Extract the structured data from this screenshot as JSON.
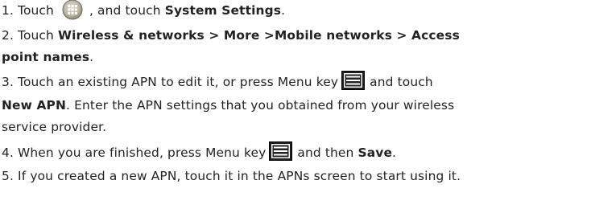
{
  "steps": [
    {
      "prefix": "1. Touch",
      "mid": ", and touch",
      "target": "System Settings",
      "end": "."
    },
    {
      "prefix": "2. Touch",
      "path": "Wireless & networks > More >Mobile networks > Access",
      "path_cont": "point names",
      "end": "."
    },
    {
      "prefix": "3. Touch an existing APN to edit it, or press Menu key",
      "mid": "and touch",
      "target": "New APN",
      "rest": ". Enter the APN settings that you obtained from your wireless",
      "rest_cont": "service provider."
    },
    {
      "prefix": "4. When you are finished, press Menu key",
      "mid": "and then",
      "target": "Save",
      "end": "."
    },
    {
      "text": "5. If you created a new APN, touch it in the APNs screen to start using it."
    }
  ],
  "icons": {
    "apps": "apps-launcher-icon",
    "menu": "menu-key-icon"
  }
}
